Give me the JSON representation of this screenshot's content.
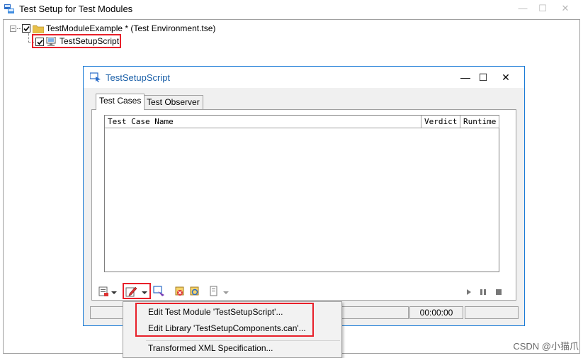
{
  "outer_window": {
    "title": "Test Setup for Test Modules",
    "minimize": "—",
    "maximize": "☐",
    "close": "✕"
  },
  "tree": {
    "root_label": "TestModuleExample *  (Test Environment.tse)",
    "child_label": "TestSetupScript",
    "expander_symbol": "−"
  },
  "dialog": {
    "title": "TestSetupScript",
    "minimize": "—",
    "maximize": "☐",
    "close": "✕",
    "tabs": [
      {
        "label": "Test Cases",
        "active": true
      },
      {
        "label": "Test Observer",
        "active": false
      }
    ],
    "columns": [
      "Test Case Name",
      "Verdict",
      "Runtime"
    ],
    "status_time": "00:00:00"
  },
  "context_menu": {
    "items": [
      "Edit Test Module 'TestSetupScript'...",
      "Edit Library 'TestSetupComponents.can'...",
      "Transformed XML Specification..."
    ]
  },
  "watermark_text": "CSDN @小猫爪",
  "colors": {
    "highlight_red": "#e8202a",
    "dialog_border": "#1a7bd6",
    "dialog_title": "#1a5fa8",
    "folder_yellow": "#e8c04a"
  }
}
